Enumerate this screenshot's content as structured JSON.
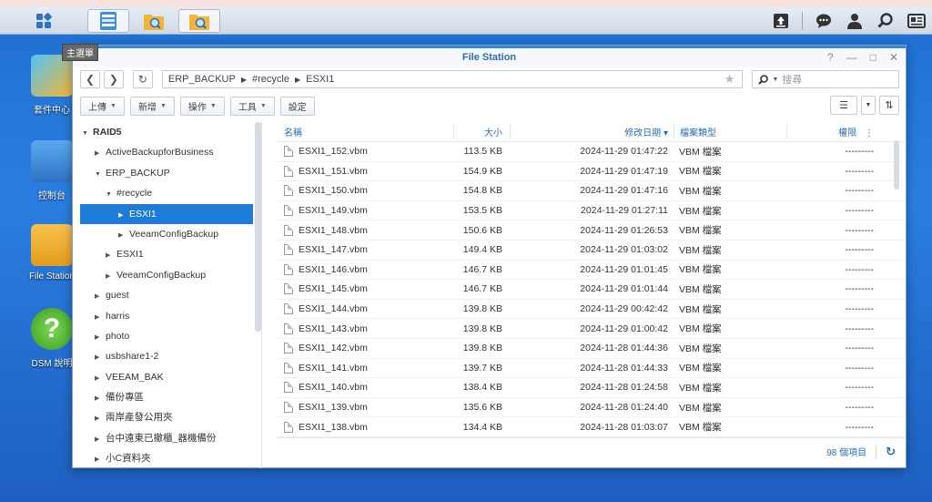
{
  "taskbar": {
    "main_menu_tooltip": "主選單"
  },
  "desktop": {
    "icons": [
      {
        "label": "套件中心"
      },
      {
        "label": "控制台"
      },
      {
        "label": "File Station"
      },
      {
        "label": "DSM 說明"
      }
    ]
  },
  "window": {
    "title": "File Station",
    "controls": {
      "help": "?",
      "minimize": "—",
      "maximize": "□",
      "close": "✕"
    }
  },
  "nav": {
    "path": [
      "ERP_BACKUP",
      "#recycle",
      "ESXI1"
    ],
    "search_placeholder": "搜尋"
  },
  "toolbar": {
    "upload": "上傳",
    "create": "新增",
    "action": "操作",
    "tools": "工具",
    "settings": "設定"
  },
  "tree": {
    "items": [
      {
        "label": "RAID5",
        "level": 0,
        "arrow": "▼",
        "root": true
      },
      {
        "label": "ActiveBackupforBusiness",
        "level": 1,
        "arrow": "▶"
      },
      {
        "label": "ERP_BACKUP",
        "level": 1,
        "arrow": "▼"
      },
      {
        "label": "#recycle",
        "level": 2,
        "arrow": "▼"
      },
      {
        "label": "ESXI1",
        "level": 3,
        "arrow": "▶",
        "selected": true
      },
      {
        "label": "VeeamConfigBackup",
        "level": 3,
        "arrow": "▶"
      },
      {
        "label": "ESXI1",
        "level": 2,
        "arrow": "▶"
      },
      {
        "label": "VeeamConfigBackup",
        "level": 2,
        "arrow": "▶"
      },
      {
        "label": "guest",
        "level": 1,
        "arrow": "▶"
      },
      {
        "label": "harris",
        "level": 1,
        "arrow": "▶"
      },
      {
        "label": "photo",
        "level": 1,
        "arrow": "▶"
      },
      {
        "label": "usbshare1-2",
        "level": 1,
        "arrow": "▶"
      },
      {
        "label": "VEEAM_BAK",
        "level": 1,
        "arrow": "▶"
      },
      {
        "label": "備份專區",
        "level": 1,
        "arrow": "▶"
      },
      {
        "label": "兩岸產發公用夾",
        "level": 1,
        "arrow": "▶"
      },
      {
        "label": "台中遠東已撤櫃_器機備份",
        "level": 1,
        "arrow": "▶"
      },
      {
        "label": "小C資料夾",
        "level": 1,
        "arrow": "▶"
      }
    ]
  },
  "list": {
    "columns": {
      "name": "名稱",
      "size": "大小",
      "date": "修改日期 ▾",
      "type": "檔案類型",
      "perm": "權限"
    },
    "rows": [
      {
        "name": "ESXI1_152.vbm",
        "size": "113.5 KB",
        "date": "2024-11-29 01:47:22",
        "type": "VBM 檔案",
        "perm": "---------"
      },
      {
        "name": "ESXI1_151.vbm",
        "size": "154.9 KB",
        "date": "2024-11-29 01:47:19",
        "type": "VBM 檔案",
        "perm": "---------"
      },
      {
        "name": "ESXI1_150.vbm",
        "size": "154.8 KB",
        "date": "2024-11-29 01:47:16",
        "type": "VBM 檔案",
        "perm": "---------"
      },
      {
        "name": "ESXI1_149.vbm",
        "size": "153.5 KB",
        "date": "2024-11-29 01:27:11",
        "type": "VBM 檔案",
        "perm": "---------"
      },
      {
        "name": "ESXI1_148.vbm",
        "size": "150.6 KB",
        "date": "2024-11-29 01:26:53",
        "type": "VBM 檔案",
        "perm": "---------"
      },
      {
        "name": "ESXI1_147.vbm",
        "size": "149.4 KB",
        "date": "2024-11-29 01:03:02",
        "type": "VBM 檔案",
        "perm": "---------"
      },
      {
        "name": "ESXI1_146.vbm",
        "size": "146.7 KB",
        "date": "2024-11-29 01:01:45",
        "type": "VBM 檔案",
        "perm": "---------"
      },
      {
        "name": "ESXI1_145.vbm",
        "size": "146.7 KB",
        "date": "2024-11-29 01:01:44",
        "type": "VBM 檔案",
        "perm": "---------"
      },
      {
        "name": "ESXI1_144.vbm",
        "size": "139.8 KB",
        "date": "2024-11-29 00:42:42",
        "type": "VBM 檔案",
        "perm": "---------"
      },
      {
        "name": "ESXI1_143.vbm",
        "size": "139.8 KB",
        "date": "2024-11-29 01:00:42",
        "type": "VBM 檔案",
        "perm": "---------"
      },
      {
        "name": "ESXI1_142.vbm",
        "size": "139.8 KB",
        "date": "2024-11-28 01:44:36",
        "type": "VBM 檔案",
        "perm": "---------"
      },
      {
        "name": "ESXI1_141.vbm",
        "size": "139.7 KB",
        "date": "2024-11-28 01:44:33",
        "type": "VBM 檔案",
        "perm": "---------"
      },
      {
        "name": "ESXI1_140.vbm",
        "size": "138.4 KB",
        "date": "2024-11-28 01:24:58",
        "type": "VBM 檔案",
        "perm": "---------"
      },
      {
        "name": "ESXI1_139.vbm",
        "size": "135.6 KB",
        "date": "2024-11-28 01:24:40",
        "type": "VBM 檔案",
        "perm": "---------"
      },
      {
        "name": "ESXI1_138.vbm",
        "size": "134.4 KB",
        "date": "2024-11-28 01:03:07",
        "type": "VBM 檔案",
        "perm": "---------"
      }
    ]
  },
  "footer": {
    "count": "98 個項目"
  },
  "colors": {
    "accent": "#1e7bd8",
    "title_text": "#2a6db5",
    "desktop": "#2a7ee0"
  }
}
